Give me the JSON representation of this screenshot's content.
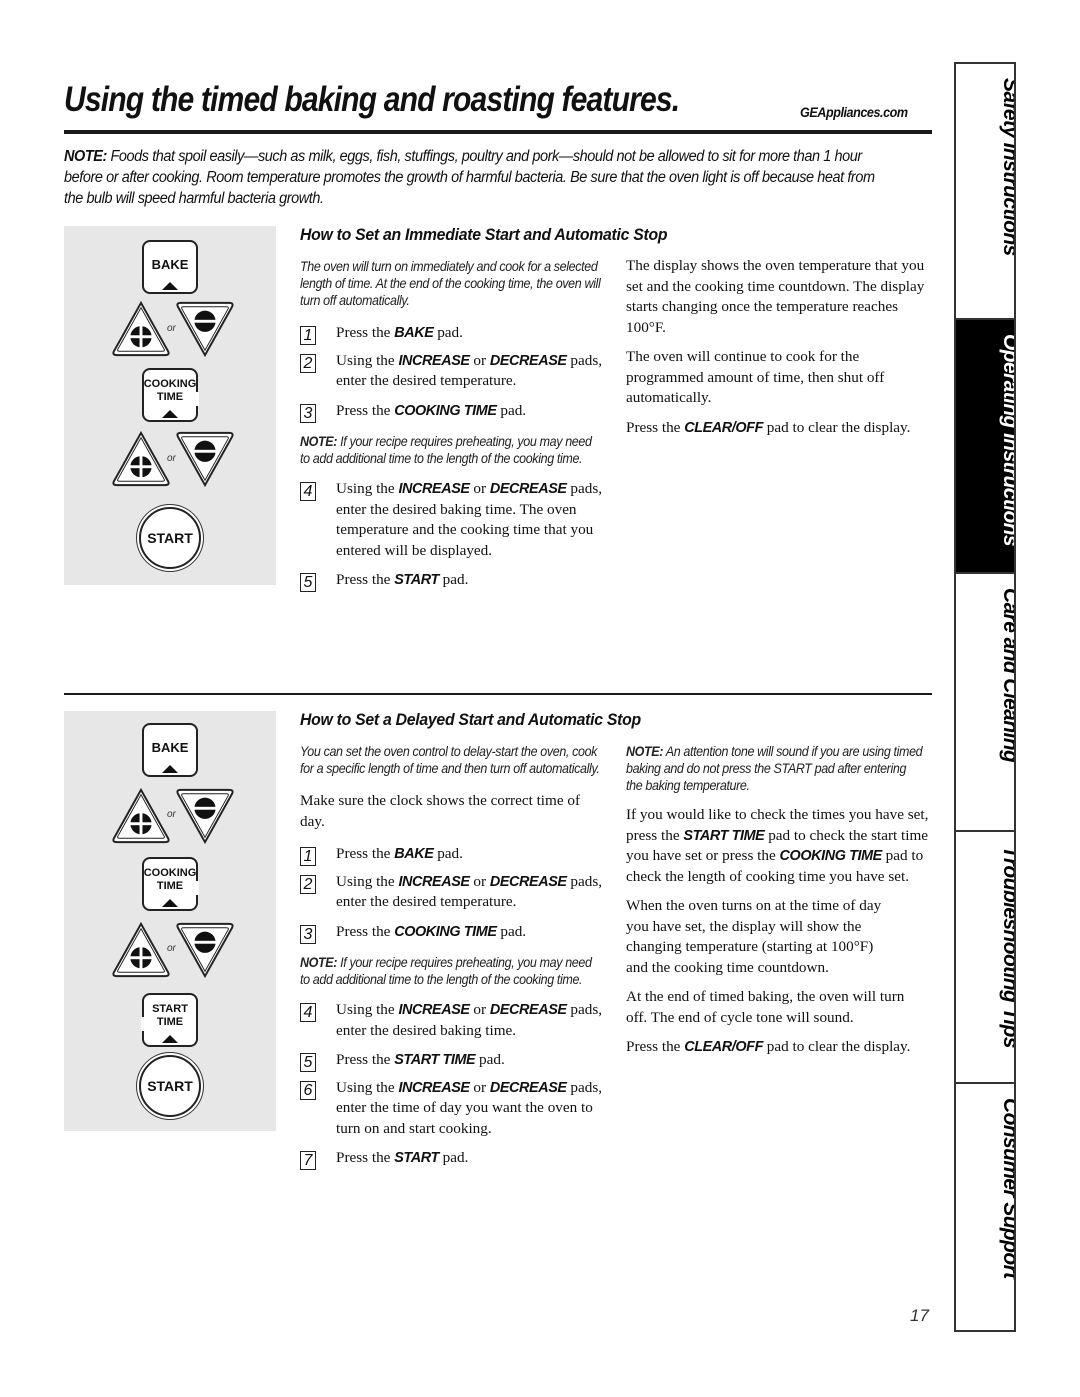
{
  "header": {
    "title": "Using the timed baking and roasting features.",
    "site": "GEAppliances.com"
  },
  "intro_note": {
    "label": "NOTE:",
    "text": " Foods that spoil easily—such as milk, eggs, fish, stuffings, poultry and pork—should not be allowed to sit for more than 1 hour before or after cooking. Room temperature promotes the growth of harmful bacteria. Be sure that the oven light is off because heat from the bulb will speed harmful bacteria growth."
  },
  "keypad": {
    "bake": "BAKE",
    "cooking": "COOKING",
    "time": "TIME",
    "start_word": "START",
    "start": "START",
    "or": "or",
    "colors": {
      "panel": "#e6e7e6",
      "ink": "#111111"
    }
  },
  "section1": {
    "heading": "How to Set an Immediate Start and Automatic Stop",
    "lead": "The oven will turn on immediately and cook for a selected length of time. At the end of the cooking time, the oven will turn off automatically.",
    "steps": [
      {
        "num": "1",
        "pre": "Press the ",
        "bold": "BAKE",
        "post": " pad."
      },
      {
        "num": "2",
        "pre": "Using the ",
        "bold": "INCREASE",
        "mid": " or ",
        "bold2": "DECREASE",
        "post": " pads, enter the desired temperature."
      },
      {
        "num": "3",
        "pre": "Press the ",
        "bold": "COOKING TIME",
        "post": " pad."
      },
      {
        "num": "4",
        "pre": "Using the ",
        "bold": "INCREASE",
        "mid": " or ",
        "bold2": "DECREASE",
        "post": " pads, enter the desired baking time. The oven temperature and the cooking time that you entered will be displayed."
      },
      {
        "num": "5",
        "pre": "Press the ",
        "bold": "START",
        "post": " pad."
      }
    ],
    "note": {
      "label": "NOTE:",
      "text": " If your recipe requires preheating, you may need to add additional time to the length of the cooking time."
    },
    "right": {
      "p1": "The display shows the oven temperature that you set and the cooking time countdown. The display starts changing once the temperature reaches 100°F.",
      "p2": "The oven will continue to cook for the programmed amount of time, then shut off automatically.",
      "p3_pre": "Press the ",
      "p3_bold": "CLEAR/OFF",
      "p3_post": " pad to clear the display."
    }
  },
  "section2": {
    "heading": "How to Set a Delayed Start and Automatic Stop",
    "lead": "You can set the oven control to delay-start the oven, cook for a specific length of time and then turn off automatically.",
    "clock": "Make sure the clock shows the correct time of day.",
    "steps": [
      {
        "num": "1",
        "pre": "Press the ",
        "bold": "BAKE",
        "post": " pad."
      },
      {
        "num": "2",
        "pre": "Using the ",
        "bold": "INCREASE",
        "mid": " or ",
        "bold2": "DECREASE",
        "post": " pads, enter the desired temperature."
      },
      {
        "num": "3",
        "pre": "Press the ",
        "bold": "COOKING TIME",
        "post": " pad."
      },
      {
        "num": "4",
        "pre": "Using the ",
        "bold": "INCREASE",
        "mid": " or ",
        "bold2": "DECREASE",
        "post": " pads, enter the desired baking time."
      },
      {
        "num": "5",
        "pre": "Press the ",
        "bold": "START TIME",
        "post": " pad."
      },
      {
        "num": "6",
        "pre": "Using the ",
        "bold": "INCREASE",
        "mid": " or ",
        "bold2": "DECREASE",
        "post": " pads, enter the time of day you want the oven to turn on and start cooking."
      },
      {
        "num": "7",
        "pre": "Press the ",
        "bold": "START",
        "post": " pad."
      }
    ],
    "note": {
      "label": "NOTE:",
      "text": " If your recipe requires preheating, you may need to add additional time to the length of the cooking time."
    },
    "right": {
      "note_label": "NOTE:",
      "note_text": " An attention tone will sound if you are using timed baking and do not press the START pad after entering the baking temperature.",
      "p1_a": "If you would like to check the times you have set, press the ",
      "p1_b1": "START TIME",
      "p1_c": " pad to check the start time you have set or press the ",
      "p1_b2": "COOKING TIME",
      "p1_d": " pad to check the length of cooking time you have set.",
      "p2": "When the oven turns on at the time of day you have set, the display will show the changing temperature (starting at 100°F) and the cooking time countdown.",
      "p3": "At the end of timed baking, the oven will turn off. The end of cycle tone will sound.",
      "p4_pre": "Press the ",
      "p4_bold": "CLEAR/OFF",
      "p4_post": " pad to clear the display."
    }
  },
  "sidebar": {
    "tabs": [
      {
        "label": "Safety Instructions",
        "active": false
      },
      {
        "label": "Operating Instructions",
        "active": true
      },
      {
        "label": "Care and Cleaning",
        "active": false
      },
      {
        "label": "Troubleshooting Tips",
        "active": false
      },
      {
        "label": "Consumer Support",
        "active": false
      }
    ]
  },
  "page_number": "17"
}
